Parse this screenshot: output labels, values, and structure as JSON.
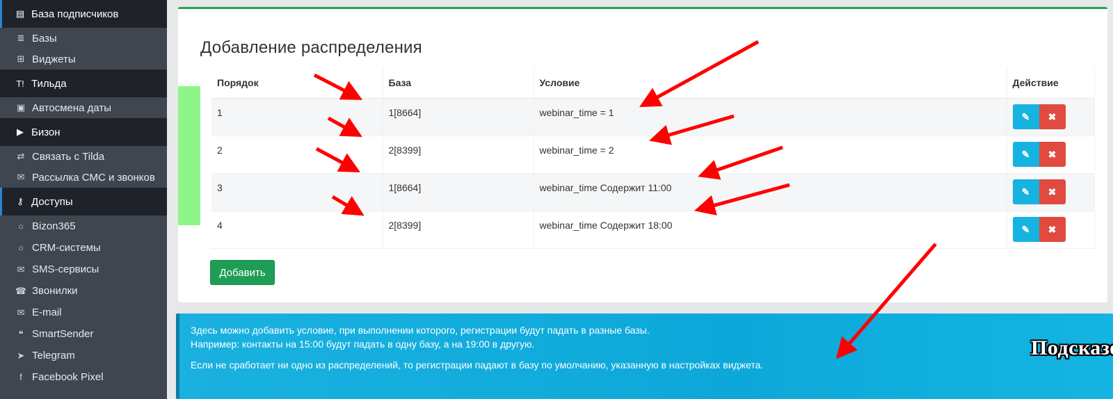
{
  "sidebar": {
    "items": [
      {
        "type": "header",
        "label": "База подписчиков",
        "icon": "database-list-icon",
        "glyph": "▤"
      },
      {
        "type": "sub",
        "label": "Базы",
        "icon": "database-icon",
        "glyph": "≣"
      },
      {
        "type": "sub",
        "label": "Виджеты",
        "icon": "widget-icon",
        "glyph": "⊞"
      },
      {
        "type": "header",
        "label": "Тильда",
        "icon": "tilda-icon",
        "glyph": "T!"
      },
      {
        "type": "sub",
        "label": "Автосмена даты",
        "icon": "calendar-plus-icon",
        "glyph": "▣"
      },
      {
        "type": "header",
        "label": "Бизон",
        "icon": "youtube-icon",
        "glyph": "▶"
      },
      {
        "type": "sub",
        "label": "Связать с Tilda",
        "icon": "exchange-icon",
        "glyph": "⇄"
      },
      {
        "type": "sub",
        "label": "Рассылка СМС и звонков",
        "icon": "envelope-icon",
        "glyph": "✉"
      },
      {
        "type": "header",
        "label": "Доступы",
        "icon": "key-icon",
        "glyph": "⚷"
      },
      {
        "type": "sub2",
        "label": "Bizon365",
        "icon": "circle-icon",
        "glyph": "○"
      },
      {
        "type": "sub2",
        "label": "CRM-системы",
        "icon": "circle-icon",
        "glyph": "○"
      },
      {
        "type": "sub2",
        "label": "SMS-сервисы",
        "icon": "envelope-icon",
        "glyph": "✉"
      },
      {
        "type": "sub2",
        "label": "Звонилки",
        "icon": "phone-icon",
        "glyph": "☎"
      },
      {
        "type": "sub2",
        "label": "E-mail",
        "icon": "envelope-icon",
        "glyph": "✉"
      },
      {
        "type": "sub2",
        "label": "SmartSender",
        "icon": "chat-icon",
        "glyph": "❝"
      },
      {
        "type": "sub2",
        "label": "Telegram",
        "icon": "telegram-icon",
        "glyph": "➤"
      },
      {
        "type": "sub2",
        "label": "Facebook Pixel",
        "icon": "facebook-icon",
        "glyph": "f"
      }
    ]
  },
  "card": {
    "title": "Добавление распределения",
    "columns": {
      "order": "Порядок",
      "base": "База",
      "condition": "Условие",
      "action": "Действие"
    },
    "rows": [
      {
        "order": "1",
        "base": "1[8664]",
        "condition": "webinar_time = 1"
      },
      {
        "order": "2",
        "base": "2[8399]",
        "condition": "webinar_time = 2"
      },
      {
        "order": "3",
        "base": "1[8664]",
        "condition": "webinar_time Содержит 11:00"
      },
      {
        "order": "4",
        "base": "2[8399]",
        "condition": "webinar_time Содержит 18:00"
      }
    ],
    "edit_icon": "pencil-icon",
    "delete_icon": "close-icon",
    "add_label": "Добавить"
  },
  "info": {
    "line1": "Здесь можно добавить условие, при выполнении которого, регистрации будут падать в разные базы.",
    "line2": "Например: контакты на 15:00 будут падать в одну базу, а на 19:00 в другую.",
    "line3": "Если не сработает ни одно из распределений, то регистрации падают в базу по умолчанию, указанную в настройках виджета."
  },
  "overlay": {
    "caption": "Подсказочка",
    "arrow_color": "#ff0000"
  },
  "colors": {
    "accent_green": "#23a05a",
    "info_blue": "#0ca8d9",
    "edit_blue": "#16b3e0",
    "delete_red": "#e04a3f",
    "sidebar_dark": "#1f2329",
    "sidebar_bg": "#3f4650"
  }
}
